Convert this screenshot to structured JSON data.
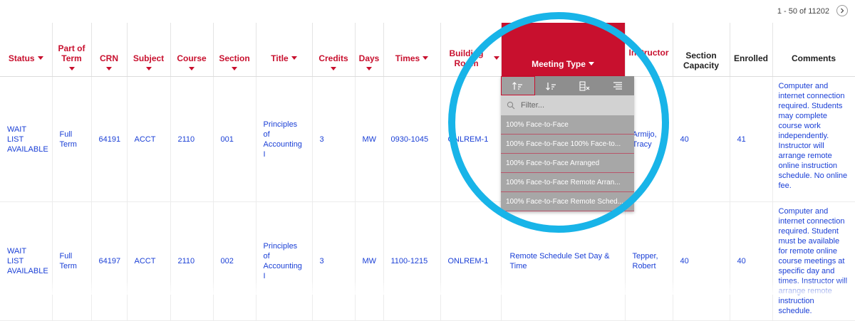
{
  "pagination": {
    "range_text": "1 - 50 of 11202"
  },
  "columns": {
    "status": "Status",
    "part_of_term": "Part of Term",
    "crn": "CRN",
    "subject": "Subject",
    "course": "Course",
    "section": "Section",
    "title": "Title",
    "credits": "Credits",
    "days": "Days",
    "times": "Times",
    "building_room": "Building Room",
    "meeting_type": "Meeting Type",
    "instructor": "Instructor",
    "section_capacity": "Section Capacity",
    "enrolled": "Enrolled",
    "comments": "Comments"
  },
  "rows": [
    {
      "status": "WAIT LIST AVAILABLE",
      "part_of_term": "Full Term",
      "crn": "64191",
      "subject": "ACCT",
      "course": "2110",
      "section": "001",
      "title": "Principles of Accounting I",
      "credits": "3",
      "days": "MW",
      "times": "0930-1045",
      "building_room": "ONLREM-1",
      "meeting_type": "",
      "instructor": "Armijo, Tracy",
      "section_capacity": "40",
      "enrolled": "41",
      "comments": "Computer and internet connection required. Students may complete course work independently. Instructor will arrange remote online instruction schedule. No online fee."
    },
    {
      "status": "WAIT LIST AVAILABLE",
      "part_of_term": "Full Term",
      "crn": "64197",
      "subject": "ACCT",
      "course": "2110",
      "section": "002",
      "title": "Principles of Accounting I",
      "credits": "3",
      "days": "MW",
      "times": "1100-1215",
      "building_room": "ONLREM-1",
      "meeting_type": "Remote Schedule Set Day & Time",
      "instructor": "Tepper, Robert",
      "section_capacity": "40",
      "enrolled": "40",
      "comments": "Computer and internet connection required. Student must be available for remote online course meetings at specific day and times. Instructor will arrange remote instruction schedule."
    }
  ],
  "dropdown": {
    "toolbar_icons": [
      "sort-ascending-icon",
      "sort-descending-icon",
      "clear-filter-icon",
      "column-align-icon"
    ],
    "filter_placeholder": "Filter...",
    "options": [
      "100% Face-to-Face",
      "100% Face-to-Face 100% Face-to...",
      "100% Face-to-Face Arranged",
      "100% Face-to-Face Remote Arran...",
      "100% Face-to-Face Remote Sched..."
    ]
  },
  "colors": {
    "accent": "#c8102e",
    "link": "#1a3fd6",
    "highlight_ring": "#18b4e8",
    "dropdown_bg": "#a7a7a7"
  }
}
